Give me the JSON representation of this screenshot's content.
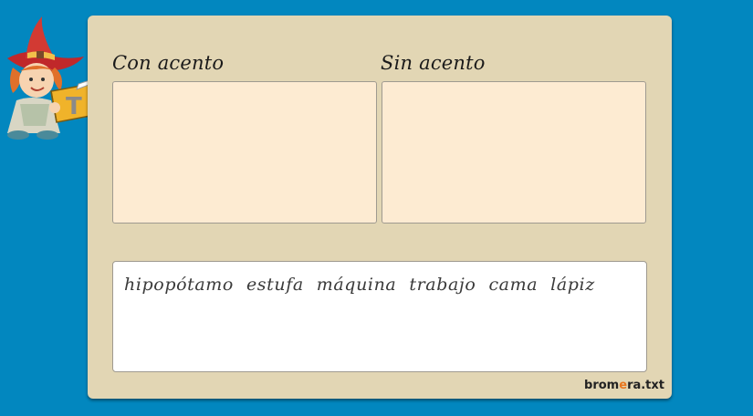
{
  "columns": {
    "with_accent_label": "Con acento",
    "without_accent_label": "Sin acento"
  },
  "word_bank": {
    "words": [
      "hipopótamo",
      "estufa",
      "máquina",
      "trabajo",
      "cama",
      "lápiz"
    ]
  },
  "brand": {
    "prefix": "brom",
    "accent_letter": "e",
    "suffix": "ra.txt"
  },
  "mascot": {
    "icon": "witch-girl-reading-book-icon",
    "book_letter": "T"
  },
  "colors": {
    "background": "#0287bf",
    "panel": "#e2d6b4",
    "drop_box": "#fdebd2",
    "brand_accent": "#e8761e"
  }
}
